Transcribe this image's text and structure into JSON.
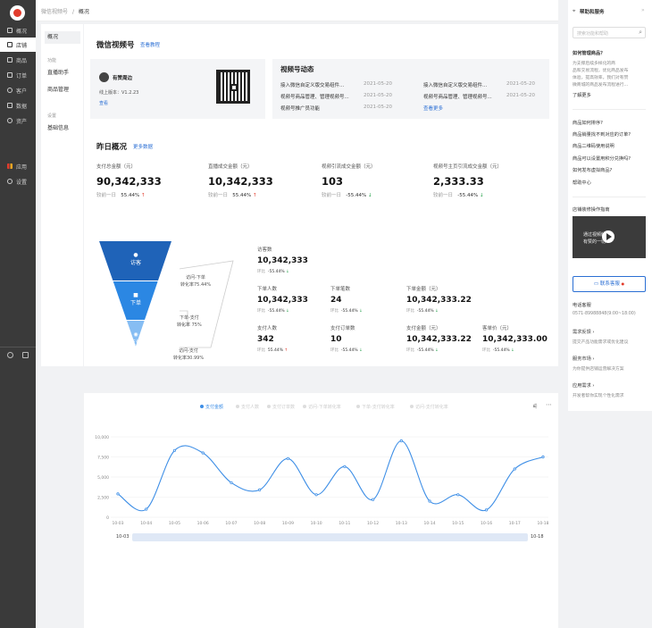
{
  "sidebar": {
    "items": [
      {
        "label": "概况",
        "icon": "overview-icon"
      },
      {
        "label": "店铺",
        "icon": "store-icon"
      },
      {
        "label": "商品",
        "icon": "goods-icon"
      },
      {
        "label": "订单",
        "icon": "order-icon"
      },
      {
        "label": "客户",
        "icon": "customer-icon"
      },
      {
        "label": "数据",
        "icon": "data-icon"
      },
      {
        "label": "资产",
        "icon": "asset-icon"
      },
      {
        "label": "应用",
        "icon": "apps-icon"
      },
      {
        "label": "设置",
        "icon": "settings-icon"
      }
    ],
    "active": "店铺"
  },
  "breadcrumb": {
    "parent": "微信视频号",
    "sep": "/",
    "current": "概况"
  },
  "subnav": {
    "top": "概况",
    "group1": "功能",
    "items1": [
      "直播助手",
      "商品管理"
    ],
    "group2": "设置",
    "items2": [
      "基础信息"
    ]
  },
  "header": {
    "title": "微信视频号",
    "tutorial": "查看教程"
  },
  "shop": {
    "name": "有赞周边",
    "version": "线上版本：V1.2.23",
    "view": "查看"
  },
  "dynamics": {
    "title": "视频号动态",
    "more": "查看更多",
    "left": [
      {
        "text": "接入微信自定义版交易组件...",
        "date": "2021-05-20"
      },
      {
        "text": "视频号商品管理、管理视频号...",
        "date": "2021-05-20"
      },
      {
        "text": "视频号推广员功能",
        "date": "2021-05-20"
      }
    ],
    "right": [
      {
        "text": "接入微信自定义版交易组件...",
        "date": "2021-05-20"
      },
      {
        "text": "视频号商品管理、管理视频号...",
        "date": "2021-05-20"
      }
    ]
  },
  "yesterday": {
    "title": "昨日概况",
    "more": "更多数据",
    "compare": "较前一日",
    "metrics": [
      {
        "label": "支付总金额（元）",
        "value": "90,342,333",
        "change": "55.44%",
        "dir": "up"
      },
      {
        "label": "直播成交金额（元）",
        "value": "10,342,333",
        "change": "55.44%",
        "dir": "up"
      },
      {
        "label": "视频引流成交金额（元）",
        "value": "103",
        "change": "-55.44%",
        "dir": "down"
      },
      {
        "label": "视频号主页引流成交金额（元）",
        "value": "2,333.33",
        "change": "-55.44%",
        "dir": "down"
      }
    ]
  },
  "funnel": {
    "stages": [
      {
        "label": "访客",
        "color": "#1f63b8"
      },
      {
        "label": "下单",
        "color": "#2b87e3"
      },
      {
        "label": "支付",
        "color": "#86bdf3"
      }
    ],
    "rates": [
      {
        "label": "访问-下单",
        "value": "转化率75.44%"
      },
      {
        "label": "下单-支付",
        "value": "转化率 75%"
      },
      {
        "label": "访问-支付",
        "value": "转化率30.99%"
      }
    ]
  },
  "stats": {
    "compare": "环比",
    "visitors": {
      "label": "访客数",
      "value": "10,342,333",
      "change": "-55.44%",
      "dir": "down"
    },
    "row2": [
      {
        "label": "下单人数",
        "value": "10,342,333",
        "change": "-55.44%",
        "dir": "down"
      },
      {
        "label": "下单笔数",
        "value": "24",
        "change": "-55.44%",
        "dir": "down"
      },
      {
        "label": "下单金额（元）",
        "value": "10,342,333.22",
        "change": "-55.44%",
        "dir": "down"
      }
    ],
    "row3": [
      {
        "label": "支付人数",
        "value": "342",
        "change": "55.44%",
        "dir": "up"
      },
      {
        "label": "支付订单数",
        "value": "10",
        "change": "-55.44%",
        "dir": "down"
      },
      {
        "label": "支付金额（元）",
        "value": "10,342,333.22",
        "change": "-55.44%",
        "dir": "down"
      },
      {
        "label": "客单价（元）",
        "value": "10,342,333.00",
        "change": "-55.44%",
        "dir": "down"
      }
    ]
  },
  "chart_legend": [
    "支付金额",
    "支付人数",
    "支付订单数",
    "访问-下单转化率",
    "下单-支付转化率",
    "访问-支付转化率"
  ],
  "chart_data": {
    "type": "line",
    "categories": [
      "10-03",
      "10-04",
      "10-05",
      "10-06",
      "10-07",
      "10-08",
      "10-09",
      "10-10",
      "10-11",
      "10-12",
      "10-13",
      "10-14",
      "10-15",
      "10-16",
      "10-17",
      "10-18"
    ],
    "series": [
      {
        "name": "支付金额",
        "values": [
          2900,
          1000,
          8300,
          8000,
          4300,
          3400,
          7300,
          2800,
          6300,
          2200,
          9500,
          2000,
          2800,
          900,
          6000,
          7500
        ]
      }
    ],
    "yticks": [
      0,
      2500,
      5000,
      7500,
      10000
    ],
    "ytick_labels": [
      "0",
      "2,500",
      "5,000",
      "7,500",
      "10,000"
    ],
    "ylim": [
      0,
      10000
    ],
    "color": "#3d8ee6",
    "range_start": "10-03",
    "range_end": "10-18"
  },
  "help": {
    "title": "帮助和服务",
    "search_placeholder": "搜索功能和帮助",
    "q1": "如何管理商品？",
    "q1_desc1": "为支撑后续多样化的商",
    "q1_desc2": "品和交易流程，优化商品发布",
    "q1_desc3": "体验，提高效率，我们对有赞",
    "q1_desc4": "微商城的商品发布流程进行...",
    "more": "了解更多",
    "faqs": [
      "商品如何排序?",
      "商品销量找不到对应的订单?",
      "商品二维码使用说明",
      "商品可以设置用积分兑换吗?",
      "如何发布虚拟商品?"
    ],
    "center": "帮助中心",
    "guide": "店铺装修操作指南",
    "video_text1": "通过视频解析",
    "video_text2": "有赞的一切",
    "service_btn": "联系客服",
    "phone_label": "电话客服",
    "phone": "0571-89988848(9:00~18:00)",
    "links": [
      {
        "title": "需求反馈",
        "desc": "提交产品功能需求或优化建议"
      },
      {
        "title": "服务市场",
        "desc": "为你提供店铺运营解决方案"
      },
      {
        "title": "应用需求",
        "desc": "开发者帮你实现个性化需求"
      }
    ]
  }
}
